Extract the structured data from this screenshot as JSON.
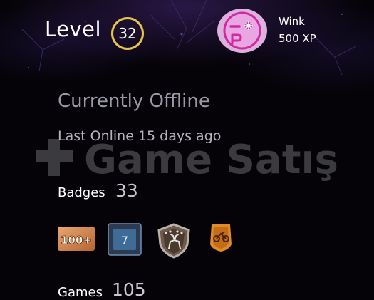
{
  "profile": {
    "level_label": "Level",
    "level": "32",
    "status": "Currently Offline",
    "last_online": "Last Online 15 days ago"
  },
  "reward": {
    "name": "Wink",
    "xp": "500 XP",
    "icon": "wink-emoji-icon"
  },
  "badges": {
    "label": "Badges",
    "count": "33",
    "items": [
      {
        "icon": "badge-100-plus-icon",
        "text": "100+"
      },
      {
        "icon": "badge-card-icon",
        "text": "7"
      },
      {
        "icon": "badge-deer-shield-icon"
      },
      {
        "icon": "badge-motorcycle-icon"
      }
    ]
  },
  "games": {
    "label": "Games",
    "count": "105"
  },
  "watermark": {
    "text": "Game Satış"
  },
  "colors": {
    "level_ring": "#e8c547",
    "avatar_bg": "#ddb1dd",
    "avatar_accent": "#d12aa0"
  }
}
